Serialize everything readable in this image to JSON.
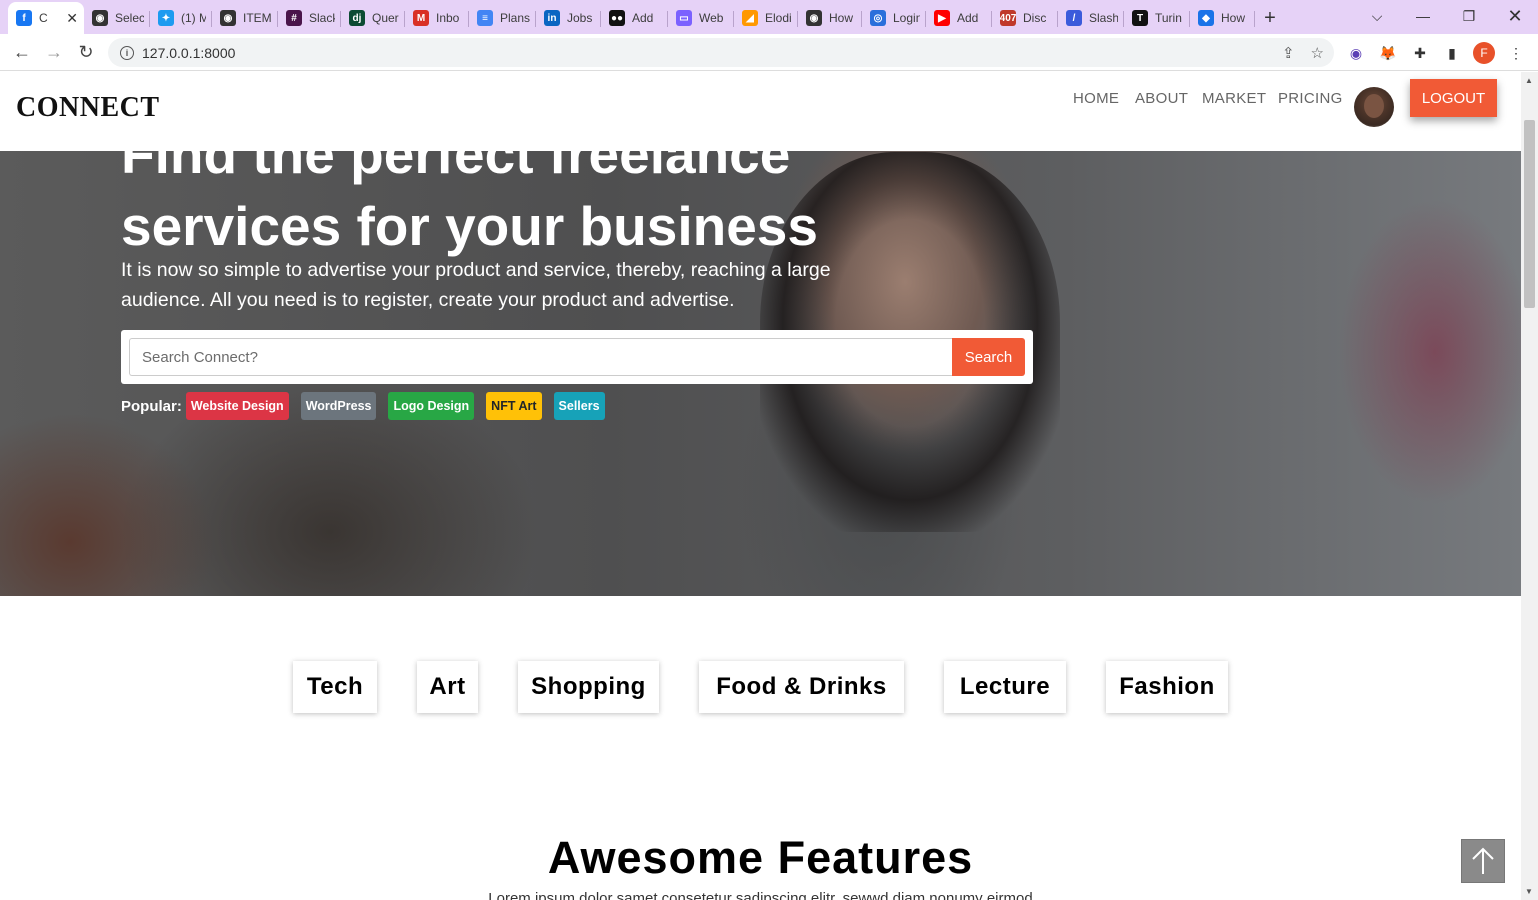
{
  "browser": {
    "tabs": [
      {
        "label": "C",
        "color": "#1877f2",
        "glyph": "f",
        "active": true
      },
      {
        "label": "Selec",
        "color": "#333",
        "glyph": "◉"
      },
      {
        "label": "(1) M",
        "color": "#1d9bf0",
        "glyph": "✦"
      },
      {
        "label": "ITEM",
        "color": "#333",
        "glyph": "◉"
      },
      {
        "label": "Slack",
        "color": "#4a154b",
        "glyph": "#"
      },
      {
        "label": "Quer",
        "color": "#0c4b33",
        "glyph": "dj"
      },
      {
        "label": "Inbo",
        "color": "#d93025",
        "glyph": "M"
      },
      {
        "label": "Plans",
        "color": "#4285f4",
        "glyph": "≡"
      },
      {
        "label": "Jobs",
        "color": "#0a66c2",
        "glyph": "in"
      },
      {
        "label": "Add",
        "color": "#111",
        "glyph": "●●"
      },
      {
        "label": "Web",
        "color": "#7b61ff",
        "glyph": "▭"
      },
      {
        "label": "Elodi",
        "color": "#ff9800",
        "glyph": "◢"
      },
      {
        "label": "How",
        "color": "#333",
        "glyph": "◉"
      },
      {
        "label": "Login",
        "color": "#2a6fdb",
        "glyph": "◎"
      },
      {
        "label": "Add",
        "color": "#ff0000",
        "glyph": "▶"
      },
      {
        "label": "Disc",
        "color": "#c0392b",
        "glyph": "407"
      },
      {
        "label": "Slash",
        "color": "#3b5bdb",
        "glyph": "/"
      },
      {
        "label": "Turin",
        "color": "#111",
        "glyph": "T"
      },
      {
        "label": "How",
        "color": "#1a73e8",
        "glyph": "◆"
      }
    ],
    "url": "127.0.0.1:8000",
    "profile_initial": "F"
  },
  "nav": {
    "brand": "CONNECT",
    "links": [
      "HOME",
      "ABOUT",
      "MARKET",
      "PRICING"
    ],
    "logout": "LOGOUT"
  },
  "hero": {
    "title_line1": "Find the perfect freelance",
    "title_line2": "services for your business",
    "subtitle": "It is now so simple to advertise your product and service, thereby, reaching a large audience. All you need is to register, create your product and advertise.",
    "search_placeholder": "Search Connect?",
    "search_button": "Search",
    "popular_label": "Popular:",
    "popular_tags": [
      {
        "label": "Website Design",
        "color": "#dc3545",
        "text": "#ffffff"
      },
      {
        "label": "WordPress",
        "color": "#6c757d",
        "text": "#ffffff"
      },
      {
        "label": "Logo Design",
        "color": "#28a745",
        "text": "#ffffff"
      },
      {
        "label": "NFT Art",
        "color": "#ffc107",
        "text": "#212529"
      },
      {
        "label": "Sellers",
        "color": "#17a2b8",
        "text": "#ffffff"
      }
    ]
  },
  "categories": [
    "Tech",
    "Art",
    "Shopping",
    "Food & Drinks",
    "Lecture",
    "Fashion"
  ],
  "features": {
    "title": "Awesome Features",
    "text": "Lorem ipsum dolor samet consetetur sadipscing elitr, sewwd diam nonumy eirmod"
  },
  "colors": {
    "accent": "#f15a36"
  }
}
